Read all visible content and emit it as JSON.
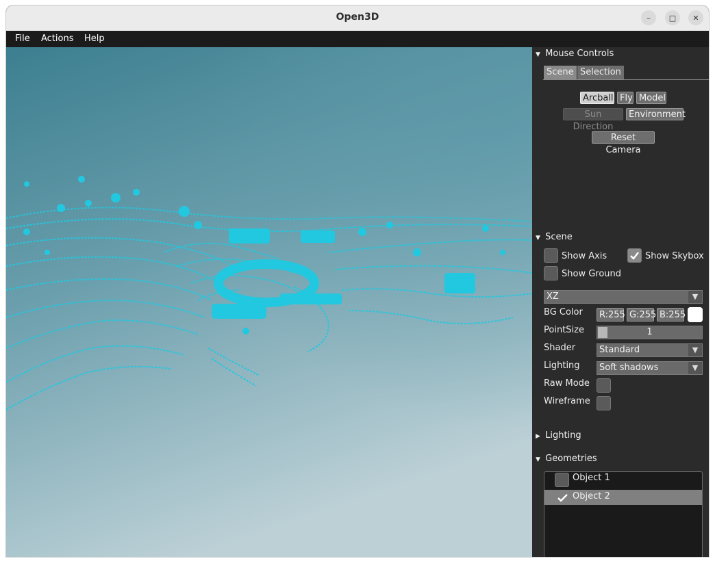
{
  "window": {
    "title": "Open3D",
    "minimize": "–",
    "maximize": "□",
    "close": "✕"
  },
  "menu": [
    "File",
    "Actions",
    "Help"
  ],
  "panel": {
    "mouse_controls": {
      "title": "Mouse Controls",
      "tabs": [
        "Scene",
        "Selection"
      ],
      "modes": [
        {
          "label": "Arcball",
          "active": true
        },
        {
          "label": "Fly",
          "active": false
        },
        {
          "label": "Model",
          "active": false
        }
      ],
      "sun_direction": "Sun Direction",
      "environment": "Environment",
      "reset_camera": "Reset Camera"
    },
    "scene": {
      "title": "Scene",
      "show_axis": {
        "label": "Show Axis",
        "checked": false
      },
      "show_skybox": {
        "label": "Show Skybox",
        "checked": true
      },
      "show_ground": {
        "label": "Show Ground",
        "checked": false
      },
      "ground_plane": "XZ",
      "bg_color": {
        "label": "BG Color",
        "r": "R:255",
        "g": "G:255",
        "b": "B:255",
        "swatch": "#ffffff"
      },
      "point_size": {
        "label": "PointSize",
        "value": "1",
        "fraction": 0.0
      },
      "shader": {
        "label": "Shader",
        "value": "Standard"
      },
      "lighting": {
        "label": "Lighting",
        "value": "Soft shadows"
      },
      "raw_mode": {
        "label": "Raw Mode",
        "checked": false
      },
      "wireframe": {
        "label": "Wireframe",
        "checked": false
      }
    },
    "lighting_section": {
      "title": "Lighting",
      "expanded": false
    },
    "geometries": {
      "title": "Geometries",
      "items": [
        {
          "label": "Object 1",
          "checked": false,
          "selected": false
        },
        {
          "label": "Object 2",
          "checked": true,
          "selected": true
        }
      ]
    }
  },
  "colors": {
    "point_cloud": "#21c8e0",
    "sky_top": "#3f8091",
    "sky_bottom": "#b6ccd3",
    "panel_bg": "#2b2b2b"
  }
}
